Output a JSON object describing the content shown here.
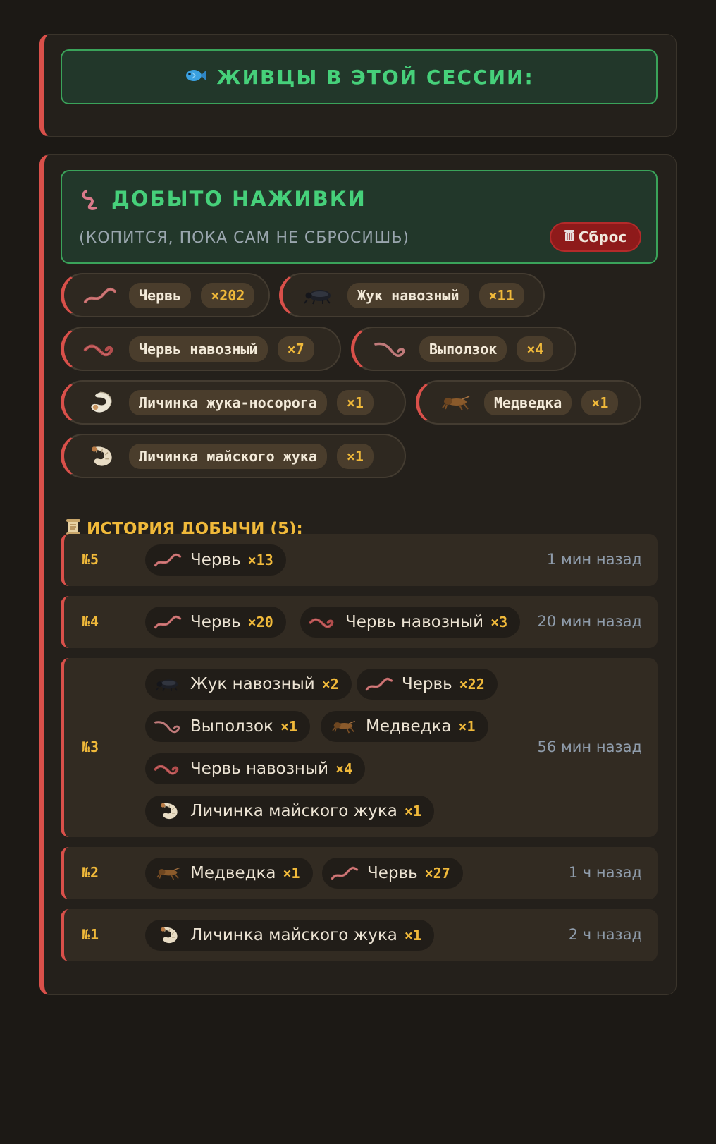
{
  "session": {
    "icon": "fish-icon",
    "title": "ЖИВЦЫ В ЭТОЙ СЕССИИ:"
  },
  "bait": {
    "icon": "worm-icon",
    "title": "ДОБЫТО НАЖИВКИ",
    "subtitle": "(КОПИТСЯ, ПОКА САМ НЕ СБРОСИШЬ)",
    "reset_label": "Сброс",
    "reset_icon": "trash-icon",
    "items": [
      {
        "name": "Червь",
        "count": "×202",
        "icon": "earthworm-icon"
      },
      {
        "name": "Жук навозный",
        "count": "×11",
        "icon": "dung-beetle-icon"
      },
      {
        "name": "Червь навозный",
        "count": "×7",
        "icon": "dung-worm-icon"
      },
      {
        "name": "Выползок",
        "count": "×4",
        "icon": "nightcrawler-icon"
      },
      {
        "name": "Личинка жука-носорога",
        "count": "×1",
        "icon": "rhino-beetle-larva-icon"
      },
      {
        "name": "Медведка",
        "count": "×1",
        "icon": "mole-cricket-icon"
      },
      {
        "name": "Личинка майского жука",
        "count": "×1",
        "icon": "cockchafer-larva-icon"
      }
    ]
  },
  "history": {
    "icon": "scroll-icon",
    "title": "ИСТОРИЯ ДОБЫЧИ (5):",
    "entries": [
      {
        "num": "№5",
        "time": "1 мин назад",
        "items": [
          {
            "name": "Червь",
            "count": "×13",
            "icon": "earthworm-icon"
          }
        ]
      },
      {
        "num": "№4",
        "time": "20 мин назад",
        "items": [
          {
            "name": "Червь",
            "count": "×20",
            "icon": "earthworm-icon"
          },
          {
            "name": "Червь навозный",
            "count": "×3",
            "icon": "dung-worm-icon"
          }
        ]
      },
      {
        "num": "№3",
        "time": "56 мин назад",
        "items": [
          {
            "name": "Жук навозный",
            "count": "×2",
            "icon": "dung-beetle-icon"
          },
          {
            "name": "Червь",
            "count": "×22",
            "icon": "earthworm-icon"
          },
          {
            "name": "Выползок",
            "count": "×1",
            "icon": "nightcrawler-icon"
          },
          {
            "name": "Медведка",
            "count": "×1",
            "icon": "mole-cricket-icon"
          },
          {
            "name": "Червь навозный",
            "count": "×4",
            "icon": "dung-worm-icon"
          },
          {
            "name": "Личинка майского жука",
            "count": "×1",
            "icon": "cockchafer-larva-icon"
          }
        ]
      },
      {
        "num": "№2",
        "time": "1 ч назад",
        "items": [
          {
            "name": "Медведка",
            "count": "×1",
            "icon": "mole-cricket-icon"
          },
          {
            "name": "Червь",
            "count": "×27",
            "icon": "earthworm-icon"
          }
        ]
      },
      {
        "num": "№1",
        "time": "2 ч назад",
        "items": [
          {
            "name": "Личинка майского жука",
            "count": "×1",
            "icon": "cockchafer-larva-icon"
          }
        ]
      }
    ]
  }
}
